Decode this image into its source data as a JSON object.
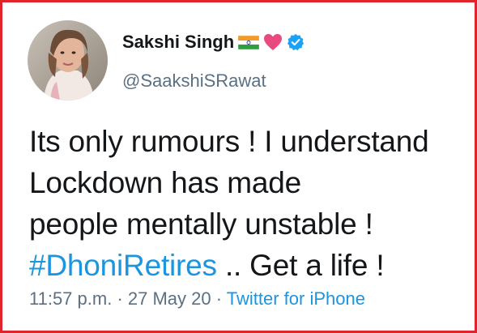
{
  "user": {
    "name": "Sakshi Singh",
    "handle": "@SaakshiSRawat"
  },
  "tweet": {
    "line1": "Its only rumours ! I understand",
    "line2": "Lockdown has made",
    "line3": "people mentally unstable !",
    "hashtag": "#DhoniRetires",
    "line4_rest": " .. Get a life !"
  },
  "meta": {
    "time": "11:57 p.m.",
    "sep1": " · ",
    "date": "27 May 20",
    "sep2": " · ",
    "source": "Twitter for iPhone"
  },
  "colors": {
    "frame_border": "#e0242b",
    "link": "#1b95e0",
    "secondary_text": "#5b7083",
    "heart": "#e8497f",
    "verified": "#1da1f2"
  },
  "icons": [
    "india-flag-icon",
    "pink-heart-icon",
    "verified-badge-icon"
  ]
}
